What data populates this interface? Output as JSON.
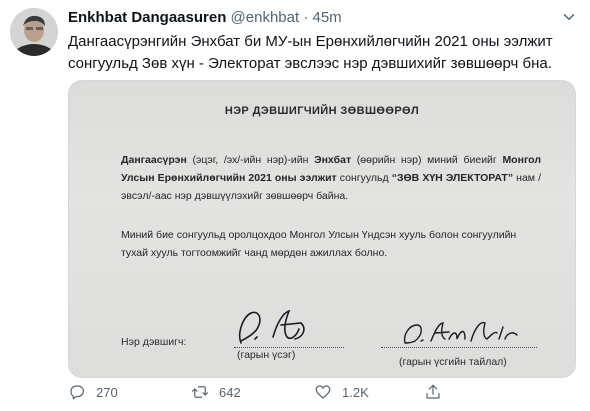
{
  "tweet": {
    "author_name": "Enkhbat Dangaasuren",
    "handle": "@enkhbat",
    "separator": "·",
    "time": "45m",
    "text": "Дангаасүрэнгийн Энхбат би МУ-ын Ерөнхийлөгчийн 2021 оны ээлжит сонгуульд Зөв хүн - Электорат эвслээс нэр дэвшихийг зөвшөөрч бна.",
    "avatar_icon": "user-avatar-photo",
    "more_icon": "chevron-down-icon"
  },
  "document": {
    "title": "НЭР ДЭВШИГЧИЙН ЗӨВШӨӨРӨЛ",
    "p1_surname": "Дангаасүрэн",
    "p1_a": " (эцэг, /эх/-ийн нэр)-ийн ",
    "p1_name": "Энхбат",
    "p1_b": " (өөрийн нэр) миний биеийг ",
    "p1_election": "Монгол Улсын Ерөнхийлөгчийн 2021 оны ээлжит",
    "p1_c": " сонгуульд ",
    "p1_coalition": "“ЗӨВ ХҮН ЭЛЕКТОРАТ”",
    "p1_d": " нам /эвсэл/-аас нэр дэвшүүлэхийг зөвшөөрч байна.",
    "p2": "Миний бие сонгуульд оролцохдоо Монгол Улсын Үндсэн хууль болон сонгуулийн тухай хууль тогтоомжийг чанд мөрдөн ажиллах болно.",
    "candidate_label": "Нэр дэвшигч:",
    "signature_label": "(гарын үсэг)",
    "decryption_label": "(гарын үсгийн тайлал)"
  },
  "actions": {
    "reply_count": "270",
    "retweet_count": "642",
    "like_count": "1.2K",
    "reply_icon": "reply-icon",
    "retweet_icon": "retweet-icon",
    "like_icon": "heart-icon",
    "share_icon": "share-icon"
  },
  "colors": {
    "text": "#0f1419",
    "muted": "#536471",
    "border": "#cfd9de",
    "paper": "#dedddb"
  }
}
